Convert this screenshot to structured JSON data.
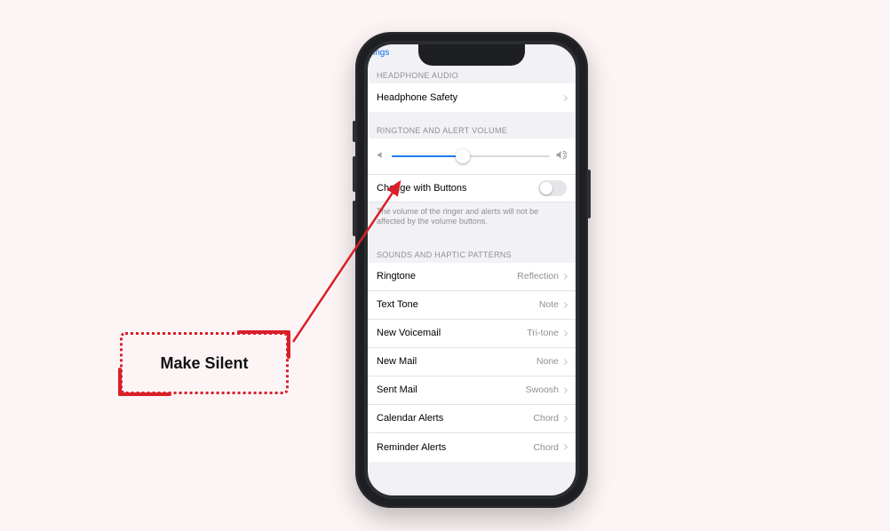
{
  "nav_back": "ings",
  "callout": {
    "label": "Make Silent"
  },
  "sections": {
    "headphone": {
      "header": "HEADPHONE AUDIO",
      "rows": [
        {
          "label": "Headphone Safety",
          "value": ""
        }
      ]
    },
    "ringtone_volume": {
      "header": "RINGTONE AND ALERT VOLUME",
      "toggle_label": "Change with Buttons",
      "footnote": "The volume of the ringer and alerts will not be affected by the volume buttons."
    },
    "sounds_haptics": {
      "header": "SOUNDS AND HAPTIC PATTERNS",
      "rows": [
        {
          "label": "Ringtone",
          "value": "Reflection"
        },
        {
          "label": "Text Tone",
          "value": "Note"
        },
        {
          "label": "New Voicemail",
          "value": "Tri-tone"
        },
        {
          "label": "New Mail",
          "value": "None"
        },
        {
          "label": "Sent Mail",
          "value": "Swoosh"
        },
        {
          "label": "Calendar Alerts",
          "value": "Chord"
        },
        {
          "label": "Reminder Alerts",
          "value": "Chord"
        }
      ]
    }
  }
}
